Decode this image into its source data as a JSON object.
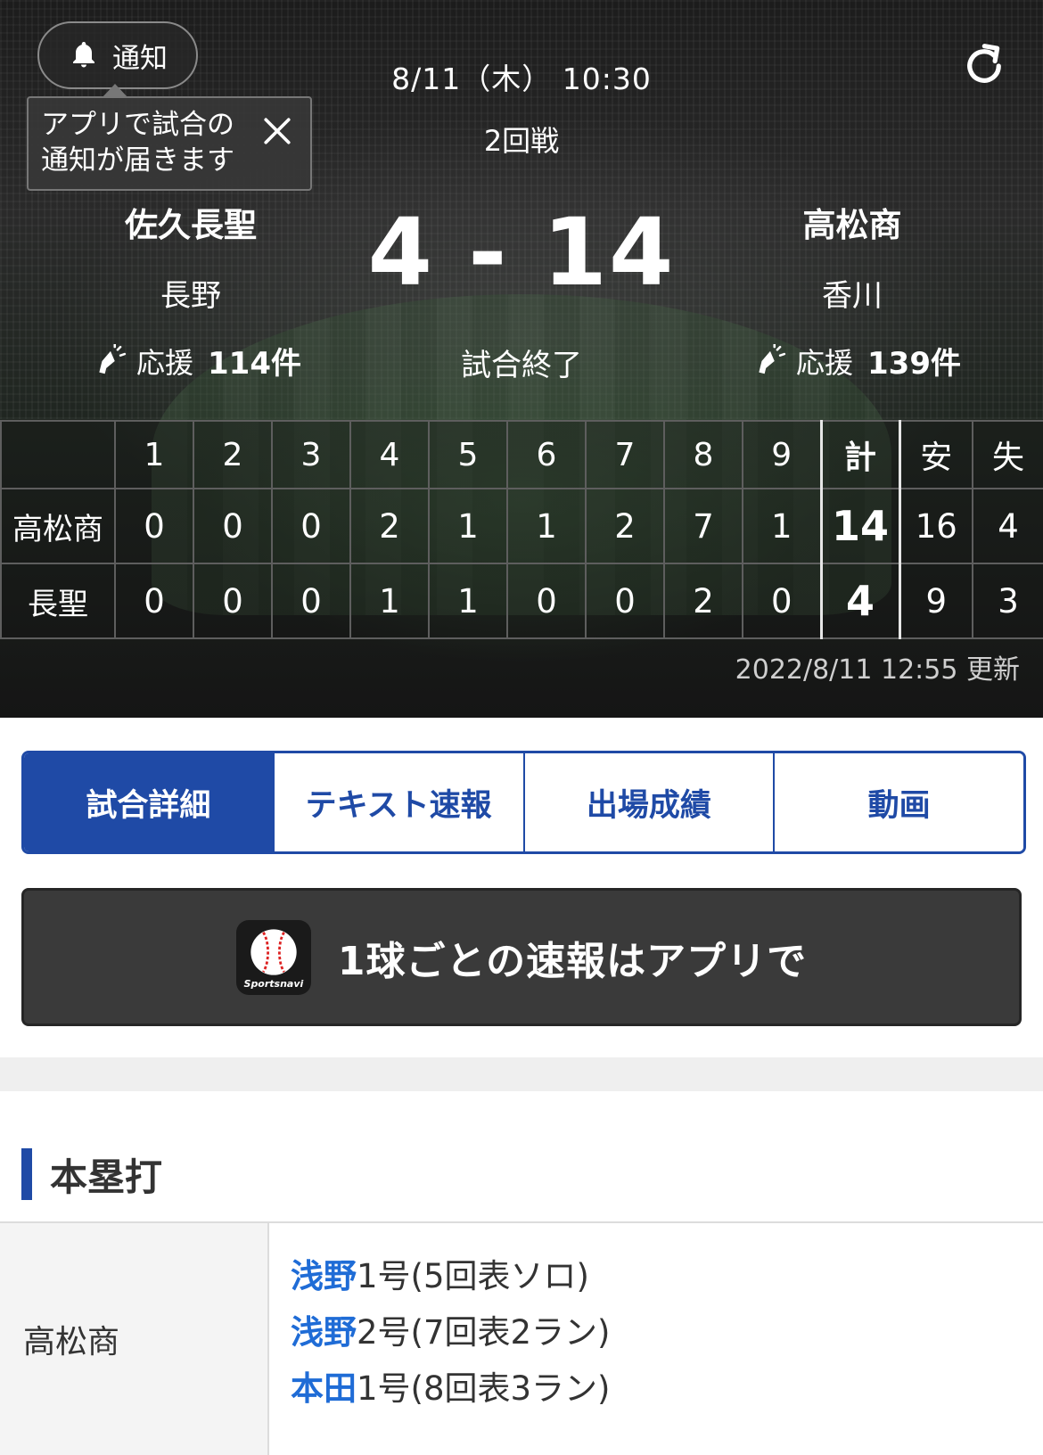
{
  "header": {
    "notify_label": "通知",
    "tooltip_text": "アプリで試合の通知が届きます",
    "datetime": "8/11（木） 10:30",
    "round": "2回戦"
  },
  "teams": {
    "left": {
      "name": "佐久長聖",
      "pref": "長野",
      "cheer_label": "応援",
      "cheer_count": "114件"
    },
    "right": {
      "name": "高松商",
      "pref": "香川",
      "cheer_label": "応援",
      "cheer_count": "139件"
    }
  },
  "score": {
    "display": "4 - 14",
    "status": "試合終了"
  },
  "scoreboard": {
    "headers": [
      "",
      "1",
      "2",
      "3",
      "4",
      "5",
      "6",
      "7",
      "8",
      "9",
      "計",
      "安",
      "失"
    ],
    "rows": [
      {
        "team": "高松商",
        "innings": [
          "0",
          "0",
          "0",
          "2",
          "1",
          "1",
          "2",
          "7",
          "1"
        ],
        "total": "14",
        "hits": "16",
        "errors": "4"
      },
      {
        "team": "長聖",
        "innings": [
          "0",
          "0",
          "0",
          "1",
          "1",
          "0",
          "0",
          "2",
          "0"
        ],
        "total": "4",
        "hits": "9",
        "errors": "3"
      }
    ],
    "updated": "2022/8/11 12:55 更新"
  },
  "tabs": [
    {
      "label": "試合詳細",
      "active": true
    },
    {
      "label": "テキスト速報",
      "active": false
    },
    {
      "label": "出場成績",
      "active": false
    },
    {
      "label": "動画",
      "active": false
    }
  ],
  "app_banner": {
    "text": "1球ごとの速報はアプリで",
    "icon_brand": "Sportsnavi"
  },
  "home_runs": {
    "title": "本塁打",
    "team": "高松商",
    "items": [
      {
        "player": "浅野",
        "detail": "1号(5回表ソロ)"
      },
      {
        "player": "浅野",
        "detail": "2号(7回表2ラン)"
      },
      {
        "player": "本田",
        "detail": "1号(8回表3ラン)"
      }
    ]
  },
  "colors": {
    "accent_blue": "#1f4aa6",
    "link_blue": "#1f6cd6",
    "hero_bg": "#1c1c1c"
  }
}
